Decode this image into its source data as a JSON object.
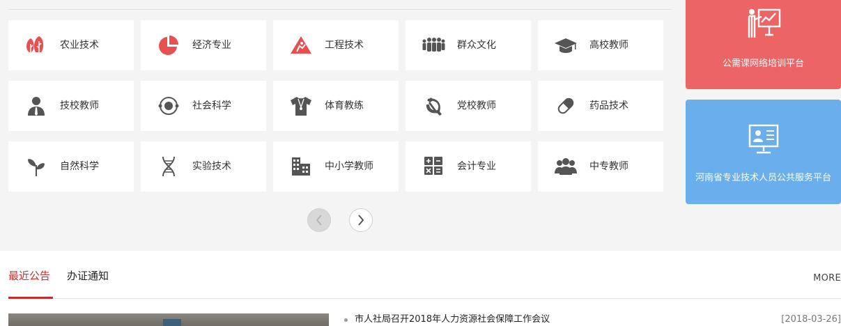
{
  "categories": [
    {
      "label": "农业技术",
      "icon": "trees-icon"
    },
    {
      "label": "经济专业",
      "icon": "pie-chart-icon"
    },
    {
      "label": "工程技术",
      "icon": "engineering-sign-icon"
    },
    {
      "label": "群众文化",
      "icon": "crowd-icon"
    },
    {
      "label": "高校教师",
      "icon": "graduation-cap-icon"
    },
    {
      "label": "技校教师",
      "icon": "teacher-person-icon"
    },
    {
      "label": "社会科学",
      "icon": "orbit-icon"
    },
    {
      "label": "体育教练",
      "icon": "whistle-shirt-icon"
    },
    {
      "label": "党校教师",
      "icon": "hammer-sickle-icon"
    },
    {
      "label": "药品技术",
      "icon": "pill-icon"
    },
    {
      "label": "自然科学",
      "icon": "sprout-icon"
    },
    {
      "label": "实验技术",
      "icon": "dna-icon"
    },
    {
      "label": "中小学教师",
      "icon": "school-building-icon"
    },
    {
      "label": "会计专业",
      "icon": "calculator-icon"
    },
    {
      "label": "中专教师",
      "icon": "group-icon"
    }
  ],
  "promos": [
    {
      "label": "公需课网络培训平台",
      "color": "#ed6465",
      "icon": "presentation-board-icon"
    },
    {
      "label": "河南省专业技术人员公共服务平台",
      "color": "#6aaeec",
      "icon": "profile-monitor-icon"
    }
  ],
  "tabs": {
    "active": "最近公告",
    "second": "办证通知",
    "more": "MORE"
  },
  "news": [
    {
      "title": "市人社局召开2018年人力资源社会保障工作会议",
      "date": "[2018-03-26]"
    }
  ],
  "colors": {
    "accent": "#c52d2d",
    "icon_red": "#e8504f",
    "icon_gray": "#555555"
  }
}
